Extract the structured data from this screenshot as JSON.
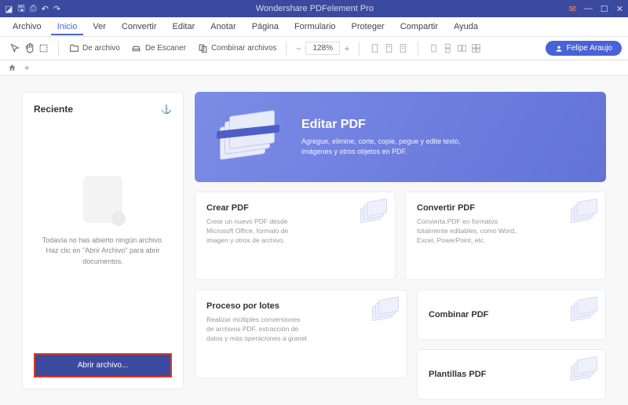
{
  "titlebar": {
    "title": "Wondershare PDFelement Pro"
  },
  "menu": {
    "items": [
      "Archivo",
      "Inicio",
      "Ver",
      "Convertir",
      "Editar",
      "Anotar",
      "Página",
      "Formulario",
      "Proteger",
      "Compartir",
      "Ayuda"
    ],
    "active_index": 1
  },
  "toolbar": {
    "open_file": "De archivo",
    "from_scanner": "De Escaner",
    "combine": "Combinar archivos",
    "zoom": "128%",
    "user": "Felipe Araujo"
  },
  "recent": {
    "title": "Reciente",
    "empty": "Todavía no has abierto ningún archivo. Haz clic en \"Abrir Archivo\" para abrir documentos.",
    "open_btn": "Abrir archivo..."
  },
  "hero": {
    "title": "Editar PDF",
    "desc": "Agregue, elimine, corte, copie, pegue y edite texto, imágenes y otros objetos en PDF."
  },
  "cards": {
    "create": {
      "title": "Crear PDF",
      "desc": "Crear un nuevo PDF desde Microsoft Office,\nformato de imagen y otros de archivo."
    },
    "convert": {
      "title": "Convertir PDF",
      "desc": "Convierta PDF en formatos totalmente editables, como Word, Excel, PowerPoint, etc."
    },
    "batch": {
      "title": "Proceso por lotes",
      "desc": "Realizar múltiples conversiones de archivos PDF, extracción de datos y más operaciones a granel."
    },
    "combine": {
      "title": "Combinar PDF"
    },
    "templates": {
      "title": "Plantillas PDF"
    }
  }
}
